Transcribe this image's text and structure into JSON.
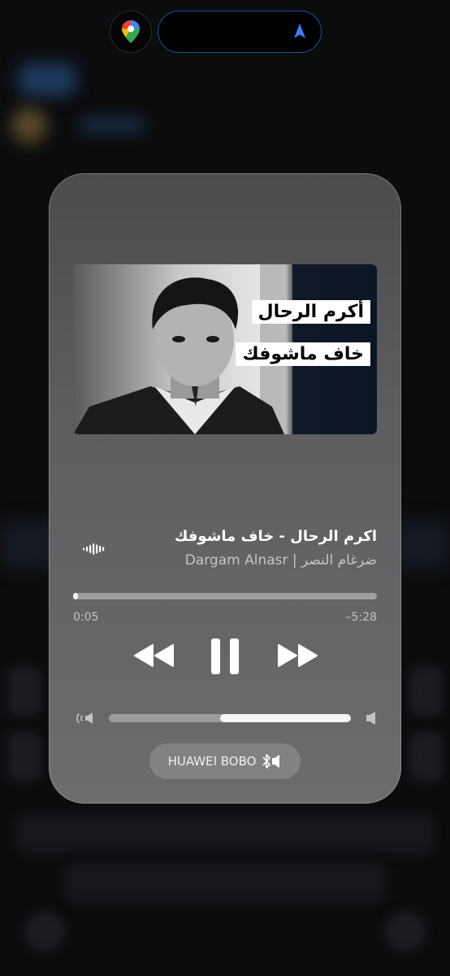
{
  "now_playing": {
    "title": "اكرم الرحال - خاف ماشوفك",
    "artist": "ضرغام النصر | Dargam Alnasr",
    "artwork": {
      "line1": "أكرم الرحال",
      "line2": "خاف ماشوفك"
    },
    "elapsed": "0:05",
    "remaining": "–5:28",
    "progress_fraction": 0.015,
    "volume_fraction": 0.54,
    "output_device": "HUAWEI BOBO"
  },
  "icons": {
    "maps": "google-maps-pin-icon",
    "navigation": "navigation-arrow-icon",
    "waveform": "waveform-icon",
    "rewind": "rewind-icon",
    "pause": "pause-icon",
    "forward": "fast-forward-icon",
    "volume_low": "speaker-low-icon",
    "volume_high": "speaker-high-icon",
    "bluetooth": "bluetooth-speaker-icon"
  },
  "colors": {
    "island_accent": "#1f4f9e",
    "nav_arrow": "#3d7cf2"
  }
}
